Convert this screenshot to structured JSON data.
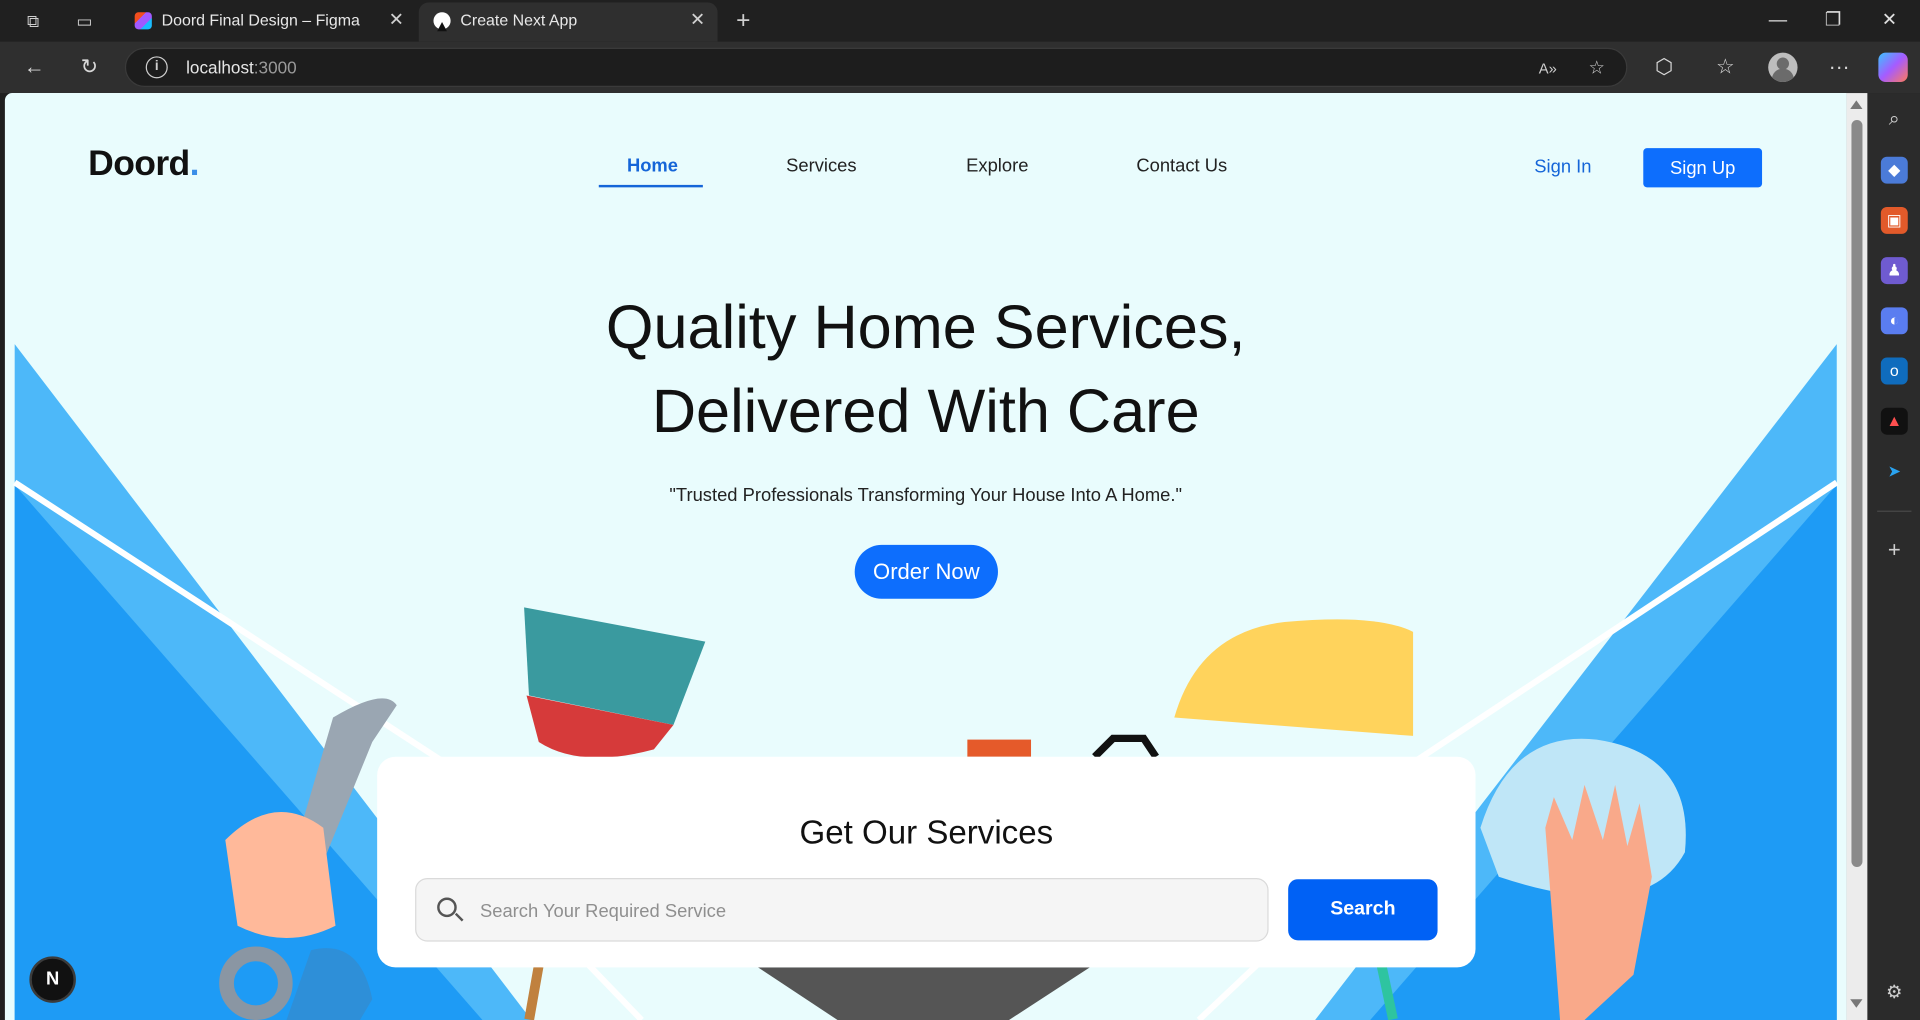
{
  "browser": {
    "tabs": [
      {
        "title": "Doord Final Design – Figma",
        "active": false
      },
      {
        "title": "Create Next App",
        "active": true
      }
    ],
    "address": {
      "host": "localhost",
      "port": ":3000"
    }
  },
  "site": {
    "logo": {
      "text": "Doord",
      "dot": "."
    },
    "nav": [
      {
        "label": "Home",
        "active": true
      },
      {
        "label": "Services",
        "active": false
      },
      {
        "label": "Explore",
        "active": false
      },
      {
        "label": "Contact Us",
        "active": false
      }
    ],
    "auth": {
      "sign_in": "Sign In",
      "sign_up": "Sign Up"
    },
    "hero": {
      "title_line1": "Quality Home Services,",
      "title_line2": "Delivered With Care",
      "subtitle": "\"Trusted Professionals Transforming Your House Into A Home.\"",
      "cta": "Order Now"
    },
    "services": {
      "heading": "Get Our Services",
      "search_placeholder": "Search Your Required Service",
      "search_button": "Search"
    },
    "dev_badge": "N"
  },
  "colors": {
    "accent": "#0d6efd",
    "hero_blue": "#1e9bf5",
    "hero_light": "#4db8f9",
    "page_bg": "#e9fcfd"
  }
}
